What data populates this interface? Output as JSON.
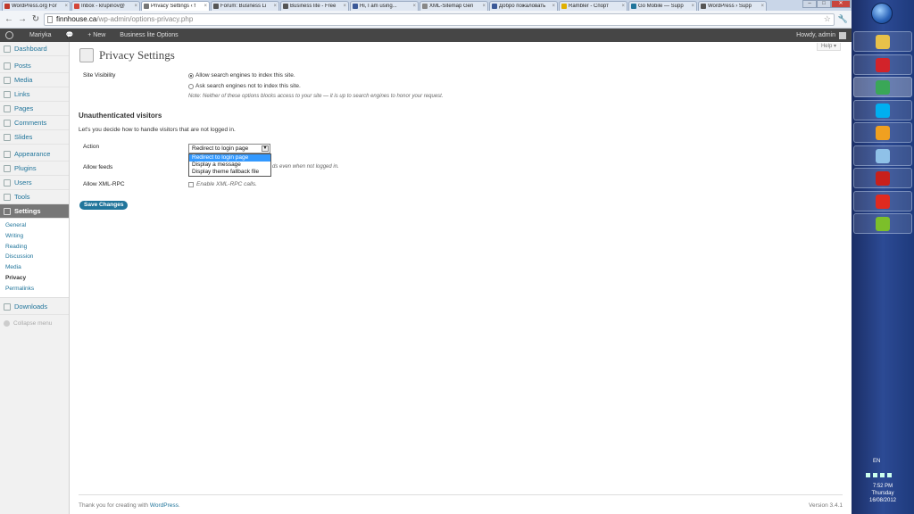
{
  "browser": {
    "tabs": [
      {
        "label": "WordPress.org For",
        "active": false,
        "color": "#c0392b"
      },
      {
        "label": "Inbox - krupinov@",
        "active": false,
        "color": "#d44638"
      },
      {
        "label": "Privacy Settings ‹ f",
        "active": true,
        "color": "#777777"
      },
      {
        "label": "Forum: Business Li",
        "active": false,
        "color": "#555555"
      },
      {
        "label": "Business lite - Free",
        "active": false,
        "color": "#555555"
      },
      {
        "label": "Hi, I am using...",
        "active": false,
        "color": "#3b5998"
      },
      {
        "label": "XML-Sitemap Gen",
        "active": false,
        "color": "#888888"
      },
      {
        "label": "Добро пожаловать",
        "active": false,
        "color": "#3b5998"
      },
      {
        "label": "Rambler - Спорт",
        "active": false,
        "color": "#e0b000"
      },
      {
        "label": "Go Mobile — Supp",
        "active": false,
        "color": "#21759b"
      },
      {
        "label": "WordPress › Supp",
        "active": false,
        "color": "#555555"
      }
    ],
    "tab_close": "×",
    "window_controls": {
      "minimize": "–",
      "maximize": "□",
      "close": "✕"
    },
    "url_host": "finnhouse.ca",
    "url_path": "/wp-admin/options-privacy.php",
    "star_icon": "☆",
    "wrench_icon": "🔧",
    "back": "←",
    "forward": "→",
    "reload": "↻"
  },
  "adminbar": {
    "site_name": "Mariyka",
    "comments_icon": "💬",
    "new_label": "+ New",
    "theme_options": "Business lite Options",
    "howdy": "Howdy, admin"
  },
  "menu": {
    "items_top": [
      {
        "label": "Dashboard",
        "icon": "dashboard-icon"
      }
    ],
    "items_content": [
      {
        "label": "Posts",
        "icon": "posts-icon"
      },
      {
        "label": "Media",
        "icon": "media-icon"
      },
      {
        "label": "Links",
        "icon": "links-icon"
      },
      {
        "label": "Pages",
        "icon": "pages-icon"
      },
      {
        "label": "Comments",
        "icon": "comments-icon"
      },
      {
        "label": "Slides",
        "icon": "slides-icon"
      }
    ],
    "items_admin": [
      {
        "label": "Appearance",
        "icon": "appearance-icon"
      },
      {
        "label": "Plugins",
        "icon": "plugins-icon"
      },
      {
        "label": "Users",
        "icon": "users-icon"
      },
      {
        "label": "Tools",
        "icon": "tools-icon"
      }
    ],
    "settings": "Settings",
    "submenu": [
      "General",
      "Writing",
      "Reading",
      "Discussion",
      "Media",
      "Privacy",
      "Permalinks"
    ],
    "current_sub": "Privacy",
    "downloads": "Downloads",
    "collapse": "Collapse menu"
  },
  "page": {
    "help": "Help ▾",
    "title": "Privacy Settings",
    "site_visibility_label": "Site Visibility",
    "radio_allow": "Allow search engines to index this site.",
    "radio_deny": "Ask search engines not to index this site.",
    "visibility_note": "Note: Neither of these options blocks access to your site — it is up to search engines to honor your request.",
    "section_heading": "Unauthenticated visitors",
    "section_desc": "Let's you decide how to handle visitors that are not logged in.",
    "action_label": "Action",
    "action_value": "Redirect to login page",
    "action_options": [
      "Redirect to login page",
      "Display a message",
      "Display theme fallback file"
    ],
    "feeds_label": "Allow feeds",
    "feeds_hint_visible": "ds even when not logged in.",
    "xmlrpc_label": "Allow XML-RPC",
    "xmlrpc_checkbox": "Enable XML-RPC calls.",
    "save": "Save Changes",
    "footer_text": "Thank you for creating with ",
    "footer_link": "WordPress",
    "footer_dot": ".",
    "version": "Version 3.4.1"
  },
  "taskbar": {
    "apps": [
      {
        "name": "explorer-icon",
        "color": "#e8c14a"
      },
      {
        "name": "opera-icon",
        "color": "#d2232a"
      },
      {
        "name": "chrome-icon",
        "color": "#3aa757"
      },
      {
        "name": "skype-icon",
        "color": "#00aff0"
      },
      {
        "name": "ebook-icon",
        "color": "#f0a020"
      },
      {
        "name": "mail-icon",
        "color": "#8fc1e8"
      },
      {
        "name": "acrobat-icon",
        "color": "#c8201b"
      },
      {
        "name": "pdf-icon",
        "color": "#e02a20"
      },
      {
        "name": "green-app-icon",
        "color": "#7cbf2a"
      }
    ],
    "lang": "EN",
    "time": "7:52 PM",
    "day": "Thursday",
    "date": "16/08/2012"
  }
}
